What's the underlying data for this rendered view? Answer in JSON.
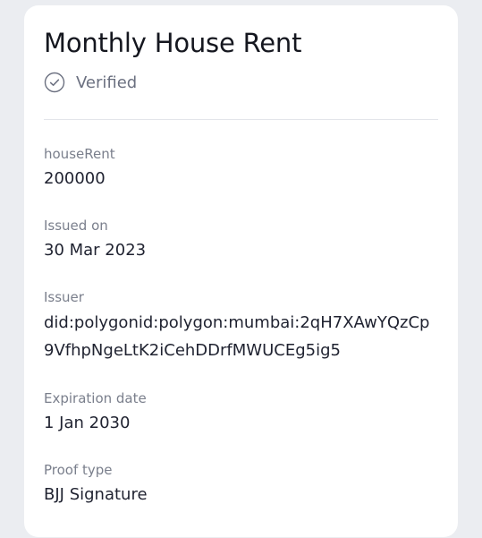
{
  "card": {
    "title": "Monthly House Rent",
    "status": "Verified",
    "fields": [
      {
        "label": "houseRent",
        "value": "200000"
      },
      {
        "label": "Issued on",
        "value": "30 Mar 2023"
      },
      {
        "label": "Issuer",
        "value": "did:polygonid:polygon:mumbai:2qH7XAwYQzCp9VfhpNgeLtK2iCehDDrfMWUCEg5ig5"
      },
      {
        "label": "Expiration date",
        "value": "1 Jan 2030"
      },
      {
        "label": "Proof type",
        "value": "BJJ Signature"
      }
    ]
  },
  "icons": {
    "status_icon": "check-circle-icon"
  },
  "colors": {
    "background": "#ebedf1",
    "card": "#ffffff",
    "text_primary": "#1f2230",
    "text_secondary": "#7a7f8c"
  }
}
